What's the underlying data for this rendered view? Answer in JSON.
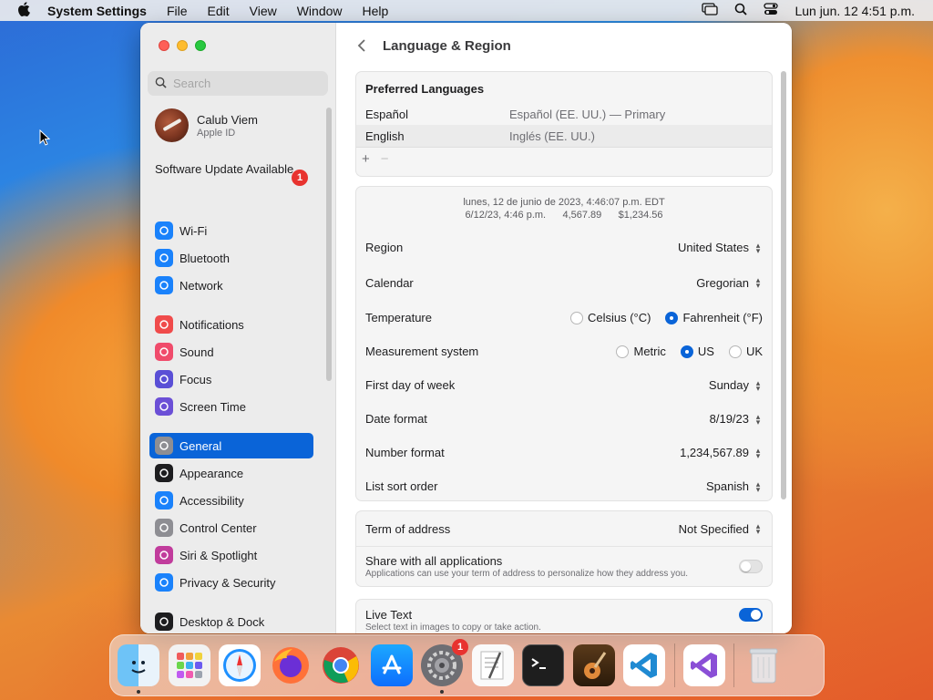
{
  "menubar": {
    "app_name": "System Settings",
    "menus": [
      "File",
      "Edit",
      "View",
      "Window",
      "Help"
    ],
    "clock": "Lun jun. 12  4:51 p.m."
  },
  "sidebar": {
    "search_placeholder": "Search",
    "user": {
      "name": "Calub Viem",
      "subtitle": "Apple ID"
    },
    "update_label": "Software Update Available",
    "update_badge": "1",
    "items": [
      {
        "label": "Wi-Fi",
        "icon": "wifi-icon",
        "color": "#1a82fb"
      },
      {
        "label": "Bluetooth",
        "icon": "bluetooth-icon",
        "color": "#1a82fb"
      },
      {
        "label": "Network",
        "icon": "globe-icon",
        "color": "#1a82fb"
      },
      {
        "label": "Notifications",
        "icon": "bell-icon",
        "color": "#f04b4b"
      },
      {
        "label": "Sound",
        "icon": "speaker-icon",
        "color": "#f04b6b"
      },
      {
        "label": "Focus",
        "icon": "moon-icon",
        "color": "#5a4fd6"
      },
      {
        "label": "Screen Time",
        "icon": "hourglass-icon",
        "color": "#6b4fd6"
      },
      {
        "label": "General",
        "icon": "gear-icon",
        "color": "#8e8e93"
      },
      {
        "label": "Appearance",
        "icon": "appearance-icon",
        "color": "#1d1d1f"
      },
      {
        "label": "Accessibility",
        "icon": "accessibility-icon",
        "color": "#1a82fb"
      },
      {
        "label": "Control Center",
        "icon": "control-center-icon",
        "color": "#8e8e93"
      },
      {
        "label": "Siri & Spotlight",
        "icon": "siri-icon",
        "color": "#c13c9c"
      },
      {
        "label": "Privacy & Security",
        "icon": "hand-icon",
        "color": "#1a82fb"
      },
      {
        "label": "Desktop & Dock",
        "icon": "dock-icon",
        "color": "#1d1d1f"
      }
    ],
    "selected": "General"
  },
  "main": {
    "title": "Language & Region",
    "preferred_languages": {
      "heading": "Preferred Languages",
      "rows": [
        {
          "name": "Español",
          "detail": "Español (EE. UU.) — Primary"
        },
        {
          "name": "English",
          "detail": "Inglés (EE. UU.)"
        }
      ],
      "add": "+",
      "remove": "−"
    },
    "preview": {
      "line1": "lunes, 12 de junio de 2023, 4:46:07 p.m. EDT",
      "line2": "6/12/23, 4:46 p.m.      4,567.89      $1,234.56"
    },
    "settings": {
      "region": {
        "label": "Region",
        "value": "United States"
      },
      "calendar": {
        "label": "Calendar",
        "value": "Gregorian"
      },
      "temperature": {
        "label": "Temperature",
        "options": [
          "Celsius (°C)",
          "Fahrenheit (°F)"
        ],
        "selected": "Fahrenheit (°F)"
      },
      "measurement": {
        "label": "Measurement system",
        "options": [
          "Metric",
          "US",
          "UK"
        ],
        "selected": "US"
      },
      "first_day": {
        "label": "First day of week",
        "value": "Sunday"
      },
      "date_format": {
        "label": "Date format",
        "value": "8/19/23"
      },
      "number_format": {
        "label": "Number format",
        "value": "1,234,567.89"
      },
      "sort_order": {
        "label": "List sort order",
        "value": "Spanish"
      }
    },
    "address": {
      "term": {
        "label": "Term of address",
        "value": "Not Specified"
      },
      "share": {
        "label": "Share with all applications",
        "sub": "Applications can use your term of address to personalize how they address you.",
        "on": false
      }
    },
    "live_text": {
      "label": "Live Text",
      "sub": "Select text in images to copy or take action.",
      "on": true
    }
  },
  "dock": {
    "apps": [
      "Finder",
      "Launchpad",
      "Safari",
      "Firefox",
      "Chrome",
      "App Store",
      "System Settings",
      "TextEdit",
      "Terminal",
      "GarageBand",
      "Visual Studio Code",
      "Visual Studio",
      "Trash"
    ],
    "system_settings_badge": "1"
  }
}
